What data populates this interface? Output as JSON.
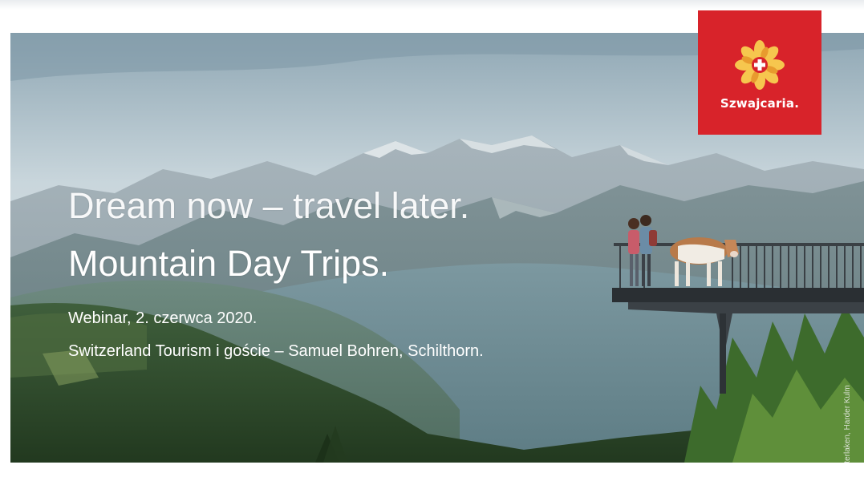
{
  "slide": {
    "title_line1": "Dream now – travel later.",
    "title_line2": "Mountain Day Trips.",
    "subtitle_line1": "Webinar, 2. czerwca 2020.",
    "subtitle_line2": "Switzerland Tourism i goście – Samuel Bohren, Schilthorn.",
    "photo_credit": "Interlaken, Harder Kulm"
  },
  "logo": {
    "label": "Szwajcaria.",
    "icon": "edelweiss-swiss-cross-icon",
    "background_color": "#d8232a"
  },
  "photo": {
    "icon": "mountain-landscape-photo"
  }
}
